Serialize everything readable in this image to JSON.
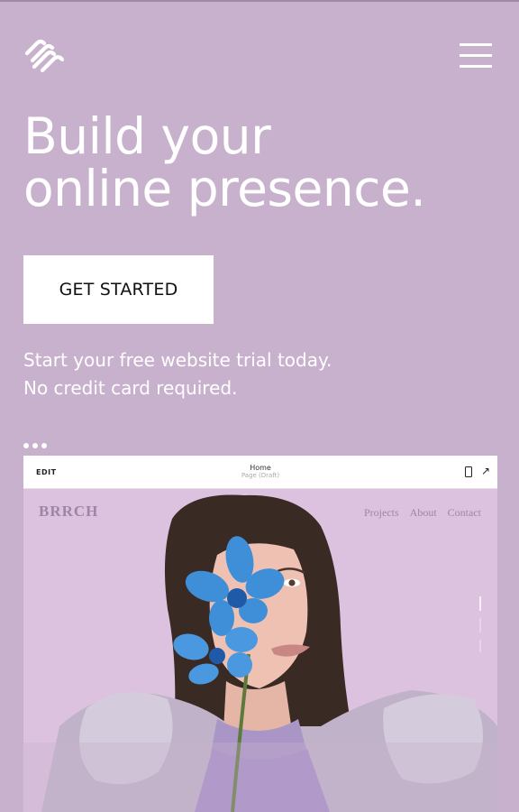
{
  "header": {
    "logo_icon": "squarespace-logo-icon",
    "menu_icon": "hamburger-menu-icon"
  },
  "hero": {
    "headline_line1": "Build your",
    "headline_line2": "online presence.",
    "cta_label": "GET STARTED",
    "sub_line1": "Start your free website trial today.",
    "sub_line2": "No credit card required."
  },
  "preview": {
    "toolbar": {
      "edit_label": "EDIT",
      "page_title": "Home",
      "page_status": "Page (Draft)",
      "mobile_icon": "mobile-preview-icon",
      "external_icon": "external-link-icon"
    },
    "site": {
      "logo": "BRRCH",
      "nav": [
        "Projects",
        "About",
        "Contact"
      ]
    }
  },
  "colors": {
    "background": "#c8b1cc",
    "preview_bg": "#dcc2df",
    "orchid": "#3e8ed8",
    "text": "#ffffff"
  }
}
